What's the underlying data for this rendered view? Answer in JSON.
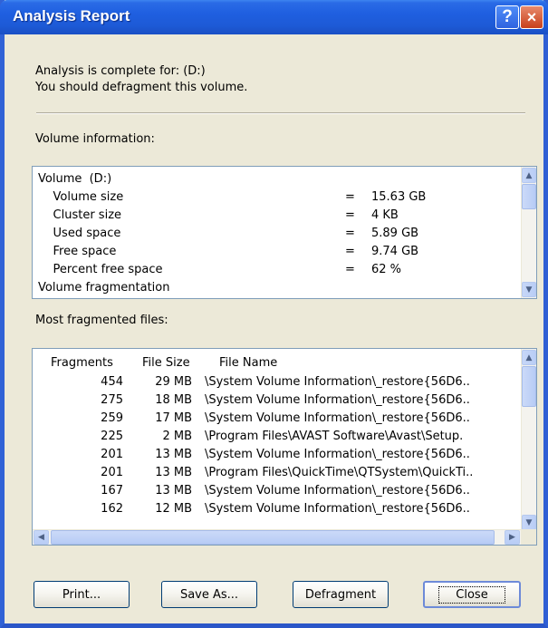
{
  "window": {
    "title": "Analysis Report"
  },
  "titlebar": {
    "help_icon": "?",
    "close_icon": "×"
  },
  "summary": {
    "line1": "Analysis is complete for: (D:)",
    "line2": "You should defragment this volume."
  },
  "volume_info": {
    "label": "Volume information:",
    "rows": [
      {
        "label": "Volume  (D:)",
        "eq": "",
        "value": ""
      },
      {
        "label": "    Volume size",
        "eq": "=",
        "value": "15.63 GB"
      },
      {
        "label": "    Cluster size",
        "eq": "=",
        "value": "4 KB"
      },
      {
        "label": "    Used space",
        "eq": "=",
        "value": "5.89 GB"
      },
      {
        "label": "    Free space",
        "eq": "=",
        "value": "9.74 GB"
      },
      {
        "label": "    Percent free space",
        "eq": "=",
        "value": "62 %"
      },
      {
        "label": "Volume fragmentation",
        "eq": "",
        "value": ""
      }
    ]
  },
  "fragmented": {
    "label": "Most fragmented files:",
    "columns": {
      "fragments": "Fragments",
      "size": "File Size",
      "name": "File Name"
    },
    "rows": [
      {
        "fragments": "454",
        "size": "29 MB",
        "name": "\\System Volume Information\\_restore{56D6.."
      },
      {
        "fragments": "275",
        "size": "18 MB",
        "name": "\\System Volume Information\\_restore{56D6.."
      },
      {
        "fragments": "259",
        "size": "17 MB",
        "name": "\\System Volume Information\\_restore{56D6.."
      },
      {
        "fragments": "225",
        "size": "2 MB",
        "name": "\\Program Files\\AVAST Software\\Avast\\Setup."
      },
      {
        "fragments": "201",
        "size": "13 MB",
        "name": "\\System Volume Information\\_restore{56D6.."
      },
      {
        "fragments": "201",
        "size": "13 MB",
        "name": "\\Program Files\\QuickTime\\QTSystem\\QuickTi.."
      },
      {
        "fragments": "167",
        "size": "13 MB",
        "name": "\\System Volume Information\\_restore{56D6.."
      },
      {
        "fragments": "162",
        "size": "12 MB",
        "name": "\\System Volume Information\\_restore{56D6.."
      }
    ]
  },
  "buttons": {
    "print": "Print...",
    "save_as": "Save As...",
    "defragment": "Defragment",
    "close": "Close"
  },
  "colors": {
    "titlebar": "#1f5fe0",
    "dialog_bg": "#ece9d8",
    "close_button": "#c8401c"
  }
}
